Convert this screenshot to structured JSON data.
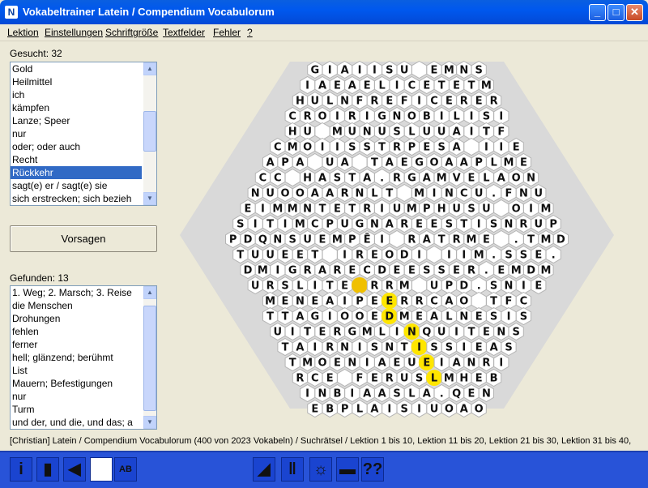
{
  "window": {
    "title": "Vokabeltrainer Latein / Compendium Vocabulorum"
  },
  "menu": [
    "Lektion",
    "Einstellungen",
    "Schriftgröße",
    "Textfelder",
    "Fehler",
    "?"
  ],
  "searched": {
    "label": "Gesucht: 32",
    "items": [
      "Gold",
      "Heilmittel",
      "ich",
      "kämpfen",
      "Lanze; Speer",
      "nur",
      "oder; oder auch",
      "Recht",
      "Rückkehr",
      "sagt(e) er / sagt(e) sie",
      "sich erstrecken; sich bezieh"
    ],
    "selected_index": 8
  },
  "hint_button": "Vorsagen",
  "found": {
    "label": "Gefunden: 13",
    "items": [
      "1. Weg; 2. Marsch; 3. Reise",
      "die Menschen",
      "Drohungen",
      "fehlen",
      "ferner",
      "hell; glänzend; berühmt",
      "List",
      "Mauern; Befestigungen",
      "nur",
      "Turm",
      "und der, und die, und das; a"
    ]
  },
  "status": "[Christian]  Latein / Compendium Vocabulorum  (400 von 2023 Vokabeln) / Suchrätsel / Lektion 1 bis 10, Lektion 11 bis 20, Lektion 21 bis 30, Lektion 31 bis 40,",
  "grid_rows": [
    "GIAIISU EMNS",
    "IAEAELICETETM",
    "HULNFREFICERER",
    "CROIRIGNOBILISI",
    "HU MUNUSLUUAITF",
    "CMOIISSTRPESA IIE",
    "APA UA TAEGOAAPLME",
    "CC HASTA.RGAMVELAON",
    "NUOOAARNLT MINCU.FNU",
    "EIMMNTETRIUMPHUSU OIM",
    "SITIMCPUGNAREESTISNRUP",
    "PDQNSUEMPĒI RATRME .TMD",
    "TUUEET IREODI IIM.SSE.",
    "DMIGRARECDEESSER.EMDM",
    "URSLITE RRM UPD.SNIE",
    "MENEAIPEERRCAO TFC",
    "TTAGIOOEDMEALNESIS",
    "UITERGMLINQUITENS",
    "TAIRNISNTISSIEAS",
    "TMOENIAEUEIANRI",
    "RCE FERUSLMHEB",
    "INBIAASLA.QEN",
    "EBPLAISIUOAO"
  ],
  "highlight": [
    [
      14,
      7
    ],
    [
      15,
      8
    ],
    [
      16,
      8
    ],
    [
      17,
      9
    ],
    [
      18,
      9
    ],
    [
      19,
      9
    ],
    [
      20,
      9
    ]
  ],
  "highlight_color": "#FFE600",
  "highlight_start_color": "#F0C000",
  "toolbar": [
    "info-icon",
    "book-icon",
    "back-icon",
    "square-icon",
    "abc-icon",
    "step-icon",
    "pause-icon",
    "bulb-icon",
    "card-icon",
    "help-icon"
  ]
}
